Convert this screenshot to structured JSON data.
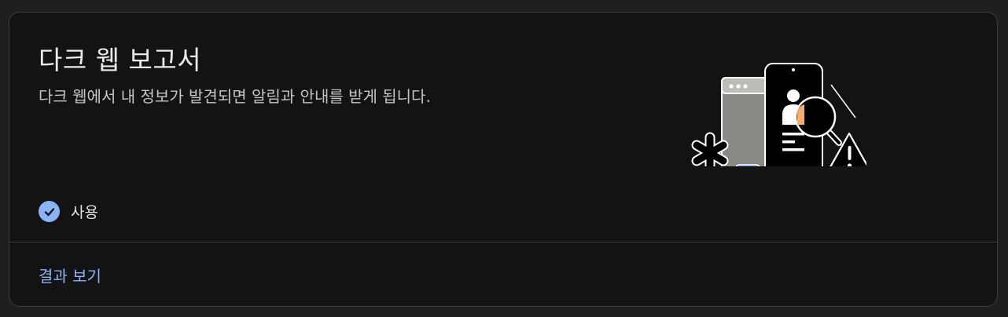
{
  "card": {
    "title": "다크 웹 보고서",
    "subtitle": "다크 웹에서 내 정보가 발견되면 알림과 안내를 받게 됩니다.",
    "illustration": "dark-web-phone-magnifier-warning",
    "status": {
      "icon": "check-circle-icon",
      "label": "사용"
    },
    "link": {
      "label": "결과 보기"
    }
  },
  "colors": {
    "background": "#1f1f1f",
    "card": "#131313",
    "accent": "#8ab4f8",
    "orange": "#f6ae6b"
  }
}
